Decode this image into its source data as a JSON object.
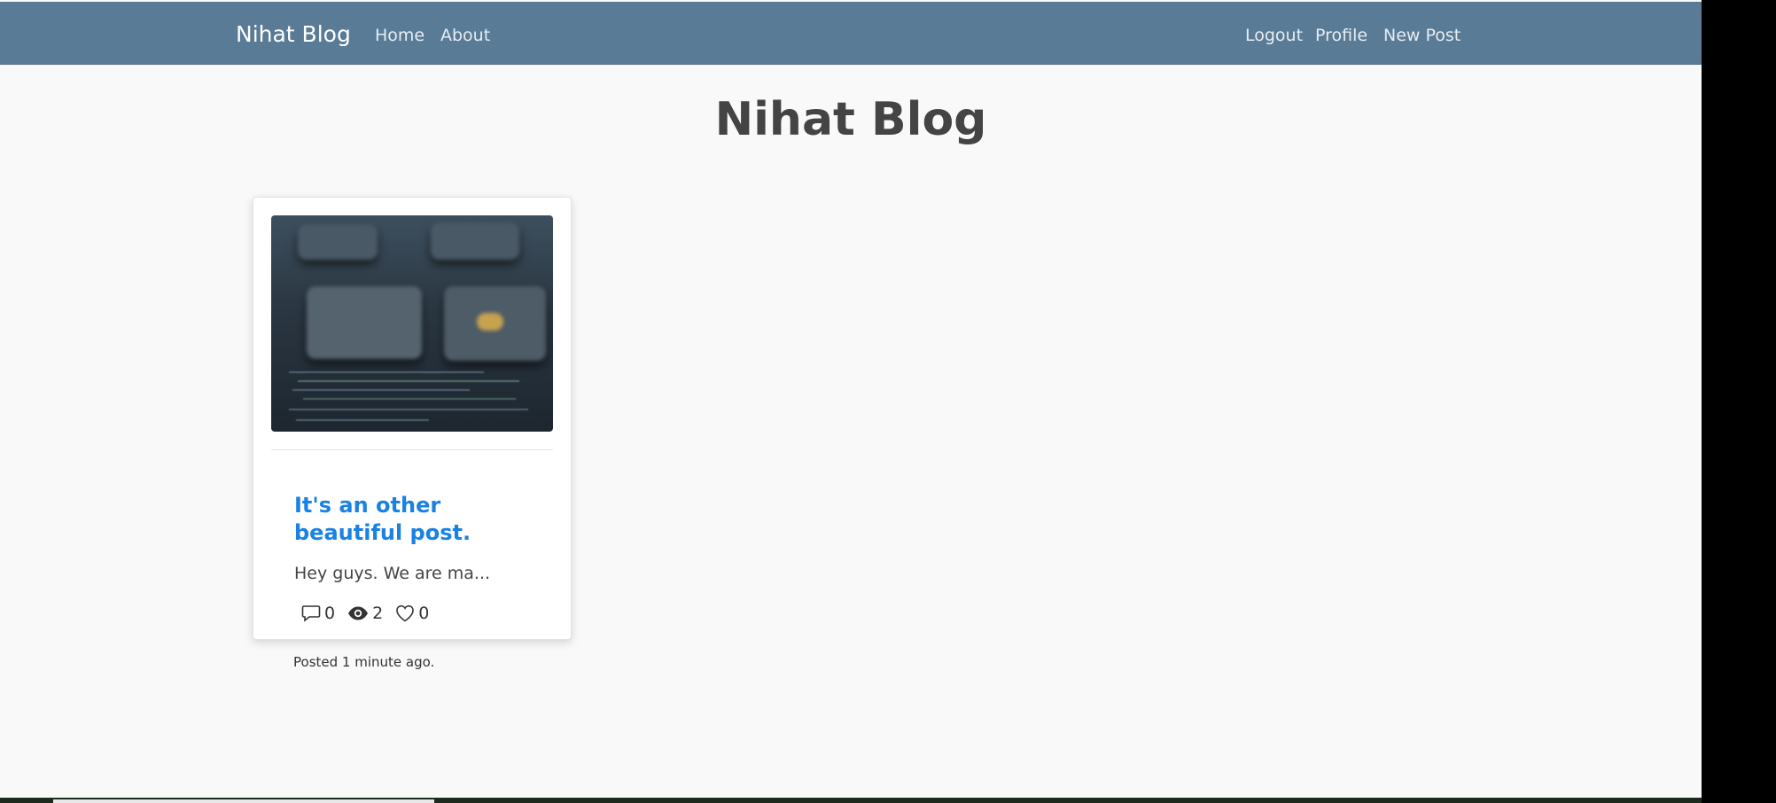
{
  "navbar": {
    "brand": "Nihat Blog",
    "left_links": [
      "Home",
      "About"
    ],
    "right_links": [
      "Logout",
      "Profile",
      "New Post"
    ]
  },
  "page": {
    "title": "Nihat Blog"
  },
  "post": {
    "title": "It's an other beautiful post.",
    "excerpt": "Hey guys. We are ma...",
    "comments": "0",
    "views": "2",
    "likes": "0",
    "posted": "Posted 1 minute ago."
  },
  "icons": {
    "comments": "comment-icon",
    "views": "eye-icon",
    "likes": "heart-icon"
  },
  "colors": {
    "navbar": "#5a7b96",
    "link": "#1a82e2",
    "background": "#f9f9f9"
  }
}
